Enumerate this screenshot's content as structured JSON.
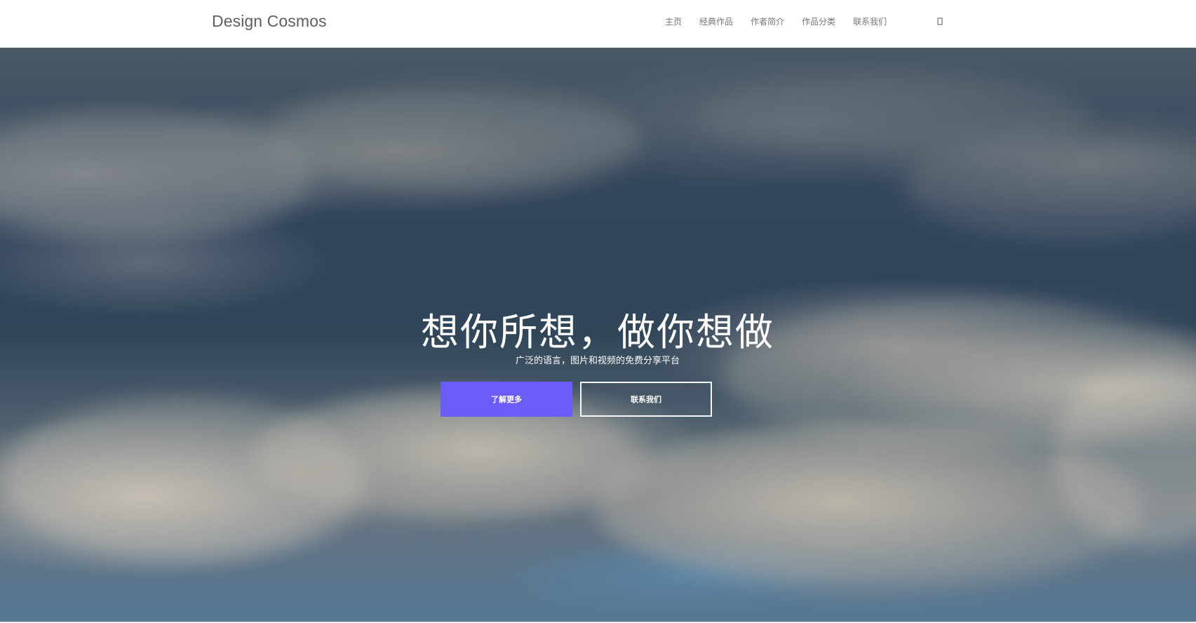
{
  "navbar": {
    "brand": "Design Cosmos",
    "items": [
      {
        "label": "主页"
      },
      {
        "label": "经典作品"
      },
      {
        "label": "作者简介"
      },
      {
        "label": "作品分类"
      },
      {
        "label": "联系我们"
      }
    ],
    "search_icon": "search-icon"
  },
  "hero": {
    "headline": "想你所想，做你想做",
    "subtitle": "广泛的语言，图片和视频的免费分享平台",
    "primary_button": "了解更多",
    "secondary_button": "联系我们",
    "accent_color": "#6c5cf7"
  }
}
